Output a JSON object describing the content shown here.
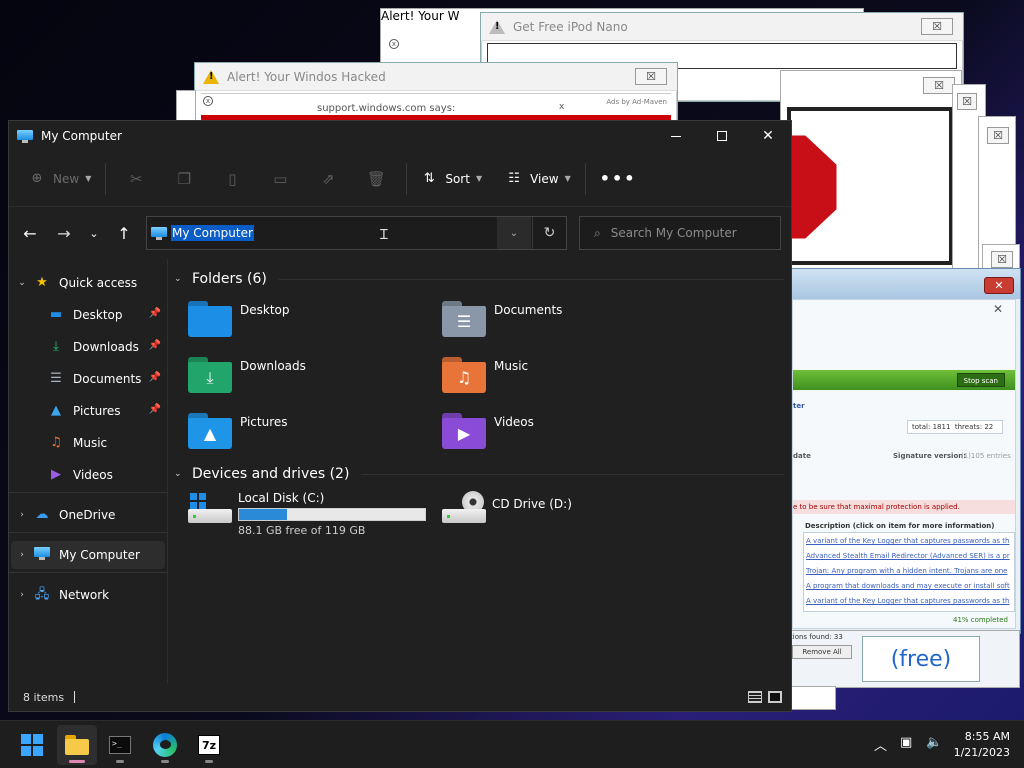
{
  "popups": {
    "alert_back_title": "Alert! Your W",
    "ipod_title": "Get Free iPod Nano",
    "hacked_title": "Alert! Your Windos Hacked",
    "support_text": "support.windows.com says:",
    "ads_text": "Ads by Ad-Maven",
    "close_glyph": "☒"
  },
  "scanner": {
    "stop_scan": "Stop scan",
    "header_fragment": "ter",
    "total_label": "total: 1811",
    "threats_label": "threats: 22",
    "date_label": "date",
    "signature_label": "Signature version:",
    "signature_value": "(1)105 entries",
    "warning_line": "e to be sure that maximal protection is applied.",
    "desc_header": "Description (click on item for more information)",
    "desc_items": [
      "A variant of the Key Logger that captures passwords as th",
      "Advanced Stealth Email Redirector (Advanced SER) is a pr",
      "Trojan: Any program with a hidden intent. Trojans are one",
      "A program that downloads and may execute or install soft",
      "A variant of the Key Logger that captures passwords as th"
    ],
    "progress_text": "41% completed",
    "progress_pct": 41,
    "found_text": "tions found: 33",
    "remove_all": "Remove All",
    "free_text": "(free)"
  },
  "window": {
    "title": "My Computer",
    "controls": {
      "minimize": "—",
      "maximize": "□",
      "close": "✕"
    }
  },
  "commandbar": {
    "new_label": "New",
    "sort_label": "Sort",
    "view_label": "View",
    "more_label": "•••"
  },
  "address": {
    "value": "My Computer",
    "search_placeholder": "Search My Computer"
  },
  "sidebar": {
    "quick_access": "Quick access",
    "pinned": [
      "Desktop",
      "Downloads",
      "Documents",
      "Pictures"
    ],
    "unpinned": [
      "Music",
      "Videos"
    ],
    "onedrive": "OneDrive",
    "mycomputer": "My Computer",
    "network": "Network"
  },
  "content": {
    "folders_header": "Folders (6)",
    "folders": [
      {
        "name": "Desktop",
        "color": "#1d8ee6",
        "glyph": ""
      },
      {
        "name": "Documents",
        "color": "#8a97a8",
        "glyph": "☰"
      },
      {
        "name": "Downloads",
        "color": "#22a56a",
        "glyph": "⤓"
      },
      {
        "name": "Music",
        "color": "#e8743a",
        "glyph": "♫"
      },
      {
        "name": "Pictures",
        "color": "#1f95e8",
        "glyph": "▲"
      },
      {
        "name": "Videos",
        "color": "#8a4bd6",
        "glyph": "▶"
      }
    ],
    "drives_header": "Devices and drives (2)",
    "drives": [
      {
        "name": "Local Disk (C:)",
        "free_text": "88.1 GB free of 119 GB",
        "used_fraction": 0.26
      },
      {
        "name": "CD Drive (D:)"
      }
    ]
  },
  "status": {
    "count": "8 items"
  },
  "taskbar": {
    "time": "8:55 AM",
    "date": "1/21/2023",
    "sevenzip": "7z",
    "term_glyph": ">_"
  }
}
